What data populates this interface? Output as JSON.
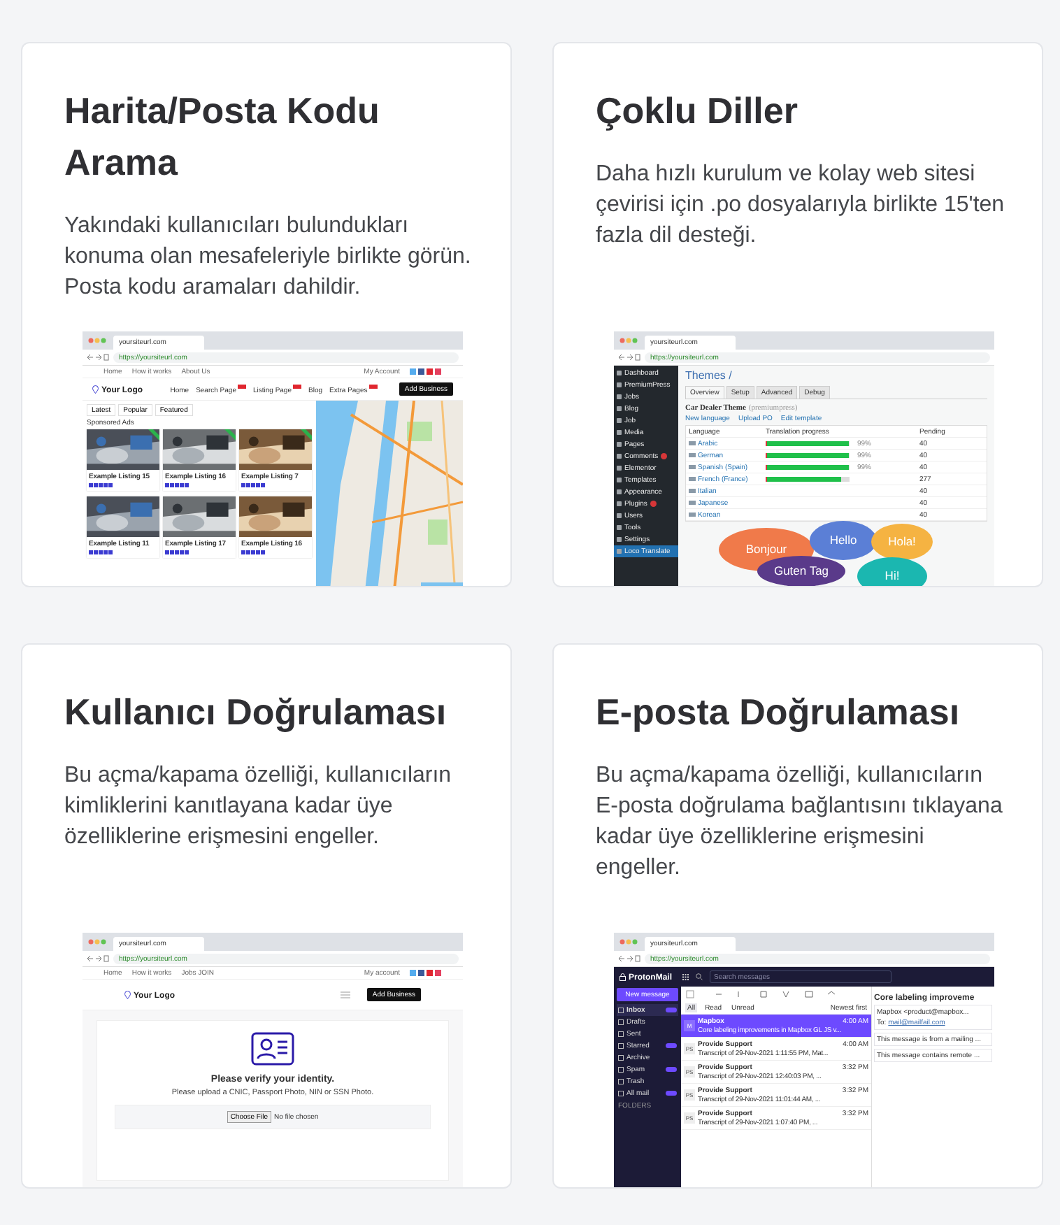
{
  "cards": [
    {
      "title": "Harita/Posta Kodu Arama",
      "description": "Yakındaki kullanıcıları bulundukları konuma olan mesafeleriyle birlikte görün. Posta kodu aramaları dahildir.",
      "shot": {
        "kind": "listings",
        "tab": "yoursiteurl.com",
        "url": "https://yoursiteurl.com",
        "top_links": [
          "Home",
          "How it works",
          "About Us"
        ],
        "account": "My Account",
        "logo": "Your Logo",
        "nav": [
          {
            "label": "Home",
            "tagged": false
          },
          {
            "label": "Search Page",
            "tagged": true
          },
          {
            "label": "Listing Page",
            "tagged": true
          },
          {
            "label": "Blog",
            "tagged": false
          },
          {
            "label": "Extra Pages",
            "tagged": true
          }
        ],
        "button": "Add Business",
        "filters": [
          "Latest",
          "Popular",
          "Featured"
        ],
        "section": "Sponsored Ads",
        "listings": [
          {
            "title": "Example Listing 15",
            "featured": true
          },
          {
            "title": "Example Listing 16",
            "featured": true
          },
          {
            "title": "Example Listing 7",
            "featured": true
          },
          {
            "title": "Example Listing 11",
            "featured": false
          },
          {
            "title": "Example Listing 17",
            "featured": false
          },
          {
            "title": "Example Listing 16",
            "featured": false
          }
        ]
      }
    },
    {
      "title": "Çoklu Diller",
      "description": "Daha hızlı kurulum ve kolay web sitesi çevirisi için .po dosyalarıyla birlikte 15'ten fazla dil desteği.",
      "shot": {
        "kind": "translation",
        "tab": "yoursiteurl.com",
        "url": "https://yoursiteurl.com",
        "menu": [
          {
            "label": "Dashboard",
            "selected": false,
            "badge": false
          },
          {
            "label": "PremiumPress",
            "selected": false,
            "badge": false
          },
          {
            "label": "Jobs",
            "selected": false,
            "badge": false
          },
          {
            "label": "Blog",
            "selected": false,
            "badge": false
          },
          {
            "label": "Job",
            "selected": false,
            "badge": false
          },
          {
            "label": "Media",
            "selected": false,
            "badge": false
          },
          {
            "label": "Pages",
            "selected": false,
            "badge": false
          },
          {
            "label": "Comments",
            "selected": false,
            "badge": true
          },
          {
            "label": "Elementor",
            "selected": false,
            "badge": false
          },
          {
            "label": "Templates",
            "selected": false,
            "badge": false
          },
          {
            "label": "Appearance",
            "selected": false,
            "badge": false
          },
          {
            "label": "Plugins",
            "selected": false,
            "badge": true
          },
          {
            "label": "Users",
            "selected": false,
            "badge": false
          },
          {
            "label": "Tools",
            "selected": false,
            "badge": false
          },
          {
            "label": "Settings",
            "selected": false,
            "badge": false
          },
          {
            "label": "Loco Translate",
            "selected": true,
            "badge": false
          }
        ],
        "heading": "Themes /",
        "tabs": [
          {
            "label": "Overview",
            "selected": true
          },
          {
            "label": "Setup",
            "selected": false
          },
          {
            "label": "Advanced",
            "selected": false
          },
          {
            "label": "Debug",
            "selected": false
          }
        ],
        "theme": "Car Dealer Theme",
        "theme_note": "(premiumpress)",
        "actions": [
          "New language",
          "Upload PO",
          "Edit template"
        ],
        "columns": [
          "Language",
          "Translation progress",
          "Pending"
        ],
        "rows": [
          {
            "language": "Arabic",
            "level": 0.99,
            "percent": "99%",
            "pending": "40"
          },
          {
            "language": "German",
            "level": 0.99,
            "percent": "99%",
            "pending": "40"
          },
          {
            "language": "Spanish (Spain)",
            "level": 0.99,
            "percent": "99%",
            "pending": "40"
          },
          {
            "language": "French (France)",
            "level": 0.9,
            "pending": "277"
          },
          {
            "language": "Italian",
            "pending": "40"
          },
          {
            "language": "Japanese",
            "pending": "40"
          },
          {
            "language": "Korean",
            "pending": "40"
          }
        ],
        "bubbles": [
          {
            "text": "Bonjour",
            "color": "#f07a4a"
          },
          {
            "text": "Hello",
            "color": "#5b7fd6"
          },
          {
            "text": "Hola!",
            "color": "#f5b342"
          },
          {
            "text": "Guten Tag",
            "color": "#5a3a8a"
          },
          {
            "text": "Hi!",
            "color": "#1bb7b0"
          }
        ]
      }
    },
    {
      "title": "Kullanıcı Doğrulaması",
      "description": "Bu açma/kapama özelliği, kullanıcıların kimliklerini kanıtlayana kadar üye özelliklerine erişmesini engeller.",
      "shot": {
        "kind": "verify",
        "tab": "yoursiteurl.com",
        "url": "https://yoursiteurl.com",
        "top_links": [
          "Home",
          "How it works",
          "Jobs JOIN"
        ],
        "account": "My account",
        "logo": "Your Logo",
        "button": "Add Business",
        "heading": "Please verify your identity.",
        "text": "Please upload a CNIC, Passport Photo, NIN or SSN Photo.",
        "file_button": "Choose File",
        "file_status": "No file chosen"
      }
    },
    {
      "title": "E-posta Doğrulaması",
      "description": "Bu açma/kapama özelliği, kullanıcıların E-posta doğrulama bağlantısını tıklayana kadar üye özelliklerine erişmesini engeller.",
      "shot": {
        "kind": "mail",
        "tab": "yoursiteurl.com",
        "url": "https://yoursiteurl.com",
        "logo": "ProtonMail",
        "search": {
          "placeholder": "Search messages"
        },
        "button": "New message",
        "folders": [
          {
            "label": "Inbox",
            "selected": true,
            "badge": true
          },
          {
            "label": "Drafts",
            "selected": false,
            "badge": false
          },
          {
            "label": "Sent",
            "selected": false,
            "badge": false
          },
          {
            "label": "Starred",
            "selected": false,
            "badge": true
          },
          {
            "label": "Archive",
            "selected": false,
            "badge": false
          },
          {
            "label": "Spam",
            "selected": false,
            "badge": true
          },
          {
            "label": "Trash",
            "selected": false,
            "badge": false
          },
          {
            "label": "All mail",
            "selected": false,
            "badge": true
          }
        ],
        "folders_heading": "FOLDERS",
        "filters": [
          {
            "label": "All",
            "selected": true
          },
          {
            "label": "Read",
            "selected": false
          },
          {
            "label": "Unread",
            "selected": false
          }
        ],
        "sort": "Newest first",
        "messages": [
          {
            "sender": "Mapbox",
            "time": "4:00 AM",
            "subject": "Core labeling improvements in Mapbox GL JS v...",
            "initials": "M",
            "selected": true
          },
          {
            "sender": "Provide Support",
            "time": "4:00 AM",
            "subject": "Transcript of 29-Nov-2021 1:11:55 PM, Mat...",
            "initials": "PS",
            "selected": false
          },
          {
            "sender": "Provide Support",
            "time": "3:32 PM",
            "subject": "Transcript of 29-Nov-2021 12:40:03 PM, ...",
            "initials": "PS",
            "selected": false
          },
          {
            "sender": "Provide Support",
            "time": "3:32 PM",
            "subject": "Transcript of 29-Nov-2021 11:01:44 AM, ...",
            "initials": "PS",
            "selected": false
          },
          {
            "sender": "Provide Support",
            "time": "3:32 PM",
            "subject": "Transcript of 29-Nov-2021 1:07:40 PM, ...",
            "initials": "PS",
            "selected": false
          }
        ],
        "reading": {
          "title": "Core labeling improveme",
          "from": "Mapbox <product@mapbox...",
          "to_label": "To:",
          "to": "mail@mailfail.com",
          "notices": [
            "This message is from a mailing ...",
            "This message contains remote ..."
          ]
        }
      }
    }
  ]
}
